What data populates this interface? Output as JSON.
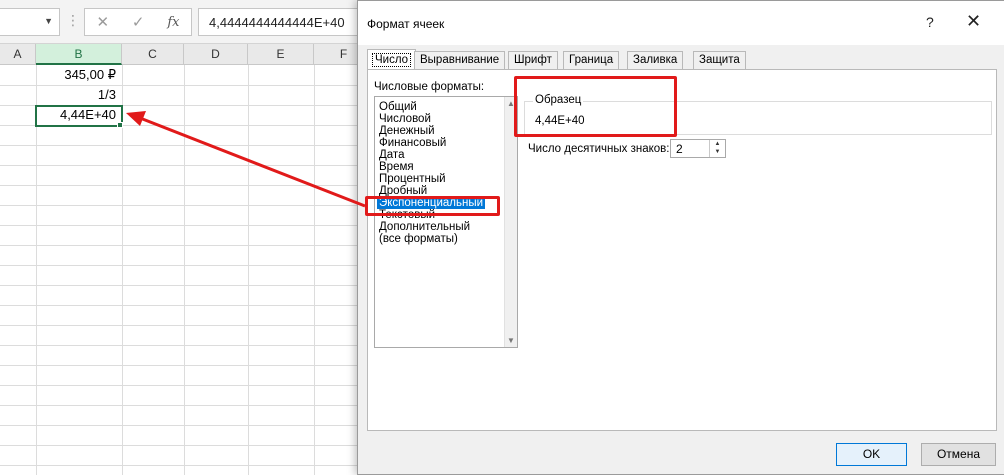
{
  "formula_bar": {
    "name_box": "",
    "cancel_icon": "✕",
    "enter_icon": "✓",
    "fx_label": "fx",
    "formula": "4,4444444444444E+40"
  },
  "sheet": {
    "columns": [
      "A",
      "B",
      "C",
      "D",
      "E",
      "F"
    ],
    "selected_column": "B",
    "cells": {
      "b1": "345,00 ₽",
      "b2": "1/3",
      "b3": "4,44E+40"
    }
  },
  "dialog": {
    "title": "Формат ячеек",
    "help": "?",
    "close": "✕",
    "tabs": [
      "Число",
      "Выравнивание",
      "Шрифт",
      "Граница",
      "Заливка",
      "Защита"
    ],
    "active_tab": "Число",
    "number_formats_label": "Числовые форматы:",
    "formats": [
      "Общий",
      "Числовой",
      "Денежный",
      "Финансовый",
      "Дата",
      "Время",
      "Процентный",
      "Дробный",
      "Экспоненциальный",
      "Текстовый",
      "Дополнительный",
      "(все форматы)"
    ],
    "selected_format": "Экспоненциальный",
    "sample_label": "Образец",
    "sample_value": "4,44E+40",
    "decimals_label": "Число десятичных знаков:",
    "decimals_value": "2",
    "ok_label": "OK",
    "cancel_label": "Отмена"
  },
  "annotation_color": "#e11a1a",
  "accent_color": "#217346"
}
